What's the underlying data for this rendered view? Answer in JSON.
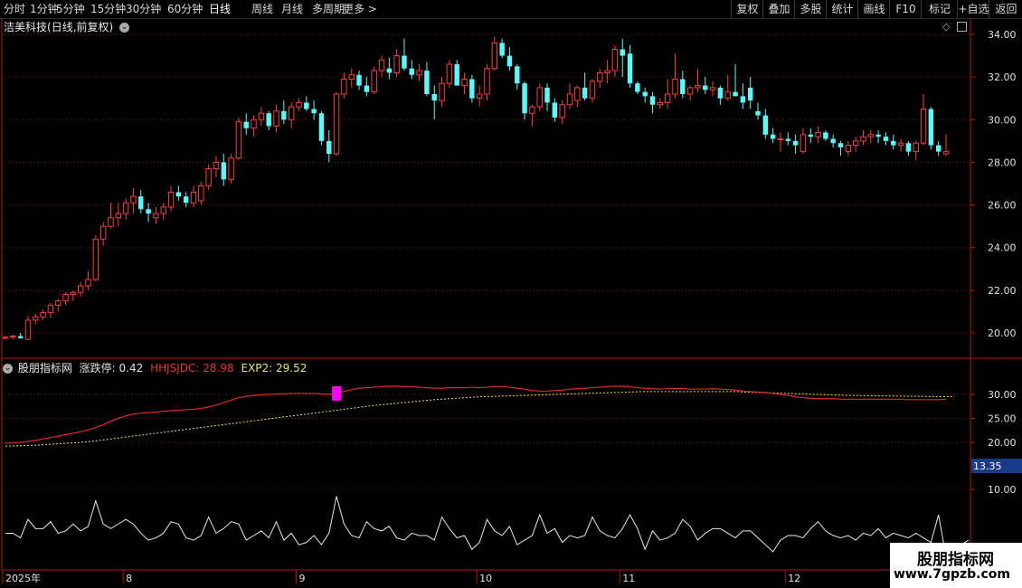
{
  "toolbar": {
    "periods": [
      "分时",
      "1分钟",
      "5分钟",
      "15分钟",
      "30分钟",
      "60分钟",
      "日线",
      "周线",
      "月线",
      "多周期",
      "更多 >"
    ],
    "active_period": "日线",
    "tools": [
      "复权",
      "叠加",
      "多股",
      "统计",
      "画线",
      "F10",
      "+自选",
      "返回"
    ],
    "marker_label": "标记"
  },
  "stock": {
    "name": "洁美科技",
    "mode": "(日线,前复权)"
  },
  "main_axis": {
    "ticks": [
      "34.00",
      "32.00",
      "30.00",
      "28.00",
      "26.00",
      "24.00",
      "22.00",
      "20.00"
    ],
    "range": [
      19.0,
      34.6
    ]
  },
  "indicator1": {
    "name": "股朋指标网",
    "items": [
      {
        "label": "涨跌停: 0.42",
        "color": "#e0e0e0"
      },
      {
        "label": "HHJSJDC: 28.98",
        "color": "#e83030"
      },
      {
        "label": "EXP2: 29.52",
        "color": "#e8e860"
      }
    ],
    "ticks": [
      "30.00",
      "25.00",
      "20.00"
    ],
    "range": [
      15.5,
      33.5
    ],
    "highlight_value": "13.35"
  },
  "indicator2": {
    "ticks": [
      "10.00"
    ],
    "range": [
      -5.5,
      13.5
    ]
  },
  "date_axis": {
    "labels": [
      {
        "text": "2025年",
        "idx": 0
      },
      {
        "text": "8",
        "idx": 16
      },
      {
        "text": "9",
        "idx": 39
      },
      {
        "text": "10",
        "idx": 63
      },
      {
        "text": "11",
        "idx": 82
      },
      {
        "text": "12",
        "idx": 104
      }
    ]
  },
  "watermark": {
    "brand": "股朋指标网",
    "url": "www.7gpzb.com"
  },
  "colors": {
    "up": "#ff3c3c",
    "down": "#54fcfc",
    "grid": "#8a1a1a",
    "axis": "#b01818",
    "hhjsjdc": "#e02828",
    "exp2": "#e6e63c",
    "wave": "#e8e8e8",
    "limit_marker": "#ff00ff"
  },
  "chart_data": {
    "type": "candlestick",
    "ohlc": [
      [
        19.75,
        19.85,
        19.7,
        19.8
      ],
      [
        19.8,
        19.9,
        19.7,
        19.85
      ],
      [
        19.85,
        20.0,
        19.75,
        19.75
      ],
      [
        19.7,
        20.8,
        19.65,
        20.6
      ],
      [
        20.6,
        20.9,
        20.4,
        20.75
      ],
      [
        20.75,
        21.1,
        20.6,
        20.95
      ],
      [
        20.95,
        21.4,
        20.7,
        21.3
      ],
      [
        21.3,
        21.6,
        21.0,
        21.5
      ],
      [
        21.5,
        21.9,
        21.3,
        21.8
      ],
      [
        21.8,
        22.0,
        21.5,
        21.9
      ],
      [
        21.9,
        22.4,
        21.7,
        22.2
      ],
      [
        22.2,
        22.9,
        22.0,
        22.5
      ],
      [
        22.5,
        24.6,
        22.4,
        24.4
      ],
      [
        24.4,
        25.2,
        24.1,
        25.0
      ],
      [
        25.0,
        26.1,
        24.9,
        25.4
      ],
      [
        25.4,
        26.1,
        25.0,
        25.6
      ],
      [
        25.6,
        26.3,
        25.3,
        26.1
      ],
      [
        26.1,
        26.8,
        25.6,
        26.4
      ],
      [
        26.4,
        26.7,
        25.6,
        25.8
      ],
      [
        25.8,
        26.1,
        25.2,
        25.6
      ],
      [
        25.4,
        25.9,
        25.1,
        25.6
      ],
      [
        25.6,
        26.1,
        25.3,
        25.9
      ],
      [
        25.9,
        26.9,
        25.7,
        26.6
      ],
      [
        26.6,
        26.9,
        26.2,
        26.4
      ],
      [
        26.4,
        26.6,
        25.9,
        26.1
      ],
      [
        26.1,
        26.9,
        25.9,
        26.6
      ],
      [
        26.2,
        27.1,
        26.0,
        26.9
      ],
      [
        26.9,
        27.9,
        26.7,
        27.7
      ],
      [
        27.7,
        28.3,
        27.3,
        28.0
      ],
      [
        28.0,
        28.4,
        26.9,
        27.2
      ],
      [
        27.2,
        28.4,
        27.0,
        28.2
      ],
      [
        28.2,
        30.1,
        28.1,
        29.9
      ],
      [
        29.9,
        30.3,
        29.3,
        29.6
      ],
      [
        29.6,
        30.2,
        29.2,
        30.0
      ],
      [
        30.0,
        30.6,
        29.7,
        30.3
      ],
      [
        30.3,
        30.4,
        29.5,
        29.7
      ],
      [
        29.7,
        30.7,
        29.4,
        30.4
      ],
      [
        30.4,
        30.9,
        29.8,
        30.0
      ],
      [
        30.0,
        30.8,
        29.6,
        30.6
      ],
      [
        30.6,
        31.0,
        30.4,
        30.8
      ],
      [
        30.8,
        31.1,
        30.4,
        30.5
      ],
      [
        30.5,
        30.9,
        30.0,
        30.3
      ],
      [
        30.3,
        30.4,
        28.8,
        29.0
      ],
      [
        29.0,
        29.5,
        28.0,
        28.4
      ],
      [
        28.4,
        31.3,
        28.3,
        31.2
      ],
      [
        31.2,
        32.2,
        31.0,
        31.9
      ],
      [
        31.9,
        32.4,
        31.5,
        32.1
      ],
      [
        32.1,
        32.3,
        31.4,
        31.6
      ],
      [
        31.6,
        32.0,
        31.1,
        31.3
      ],
      [
        31.3,
        32.5,
        31.2,
        32.3
      ],
      [
        32.3,
        33.0,
        32.0,
        32.8
      ],
      [
        32.4,
        32.9,
        31.9,
        32.2
      ],
      [
        32.2,
        33.3,
        32.0,
        33.0
      ],
      [
        33.0,
        33.8,
        32.3,
        32.4
      ],
      [
        32.4,
        32.8,
        31.9,
        32.1
      ],
      [
        32.1,
        32.6,
        31.8,
        32.3
      ],
      [
        32.3,
        32.7,
        31.1,
        31.2
      ],
      [
        31.2,
        31.6,
        30.0,
        30.9
      ],
      [
        30.9,
        32.0,
        30.6,
        31.7
      ],
      [
        31.7,
        32.8,
        31.5,
        32.6
      ],
      [
        32.6,
        32.8,
        31.6,
        31.6
      ],
      [
        31.6,
        32.2,
        31.2,
        31.9
      ],
      [
        31.9,
        32.1,
        30.8,
        31.0
      ],
      [
        31.0,
        31.6,
        30.6,
        31.2
      ],
      [
        31.2,
        32.6,
        30.9,
        32.4
      ],
      [
        32.4,
        33.9,
        32.3,
        33.6
      ],
      [
        33.6,
        33.8,
        32.9,
        33.0
      ],
      [
        33.0,
        33.4,
        32.3,
        32.5
      ],
      [
        32.5,
        32.6,
        31.4,
        31.7
      ],
      [
        31.7,
        31.8,
        30.0,
        30.3
      ],
      [
        30.3,
        30.7,
        29.7,
        30.6
      ],
      [
        30.6,
        31.7,
        30.4,
        31.5
      ],
      [
        31.5,
        31.7,
        30.4,
        30.8
      ],
      [
        30.8,
        31.0,
        29.9,
        30.1
      ],
      [
        30.1,
        30.9,
        29.8,
        30.7
      ],
      [
        30.7,
        31.7,
        30.5,
        31.2
      ],
      [
        30.9,
        31.6,
        30.6,
        31.5
      ],
      [
        31.5,
        32.2,
        30.9,
        31.0
      ],
      [
        31.0,
        31.9,
        30.8,
        31.8
      ],
      [
        31.8,
        32.4,
        31.5,
        32.2
      ],
      [
        32.2,
        32.8,
        31.7,
        32.3
      ],
      [
        32.3,
        33.5,
        32.0,
        33.3
      ],
      [
        33.3,
        33.8,
        32.0,
        33.0
      ],
      [
        33.1,
        33.5,
        31.5,
        31.7
      ],
      [
        31.7,
        31.8,
        31.2,
        31.3
      ],
      [
        31.3,
        31.5,
        30.8,
        31.1
      ],
      [
        31.1,
        31.3,
        30.3,
        30.7
      ],
      [
        30.7,
        31.0,
        30.5,
        30.8
      ],
      [
        30.8,
        31.9,
        30.5,
        31.2
      ],
      [
        31.2,
        33.1,
        31.0,
        31.9
      ],
      [
        31.9,
        32.3,
        31.0,
        31.2
      ],
      [
        31.2,
        31.6,
        30.9,
        31.5
      ],
      [
        31.5,
        32.4,
        31.3,
        31.6
      ],
      [
        31.6,
        32.0,
        31.2,
        31.4
      ],
      [
        31.4,
        31.8,
        31.1,
        31.5
      ],
      [
        31.5,
        31.6,
        30.7,
        31.0
      ],
      [
        31.0,
        32.1,
        30.9,
        31.3
      ],
      [
        31.3,
        32.6,
        31.2,
        31.1
      ],
      [
        31.1,
        31.7,
        30.5,
        30.8
      ],
      [
        31.5,
        32.0,
        30.5,
        30.9
      ],
      [
        30.4,
        30.8,
        30.0,
        30.2
      ],
      [
        30.2,
        30.5,
        29.1,
        29.3
      ],
      [
        29.3,
        29.6,
        28.9,
        29.1
      ],
      [
        29.1,
        29.4,
        28.5,
        29.1
      ],
      [
        29.1,
        29.4,
        28.8,
        29.0
      ],
      [
        29.0,
        29.3,
        28.4,
        28.8
      ],
      [
        28.5,
        29.6,
        28.4,
        29.3
      ],
      [
        29.3,
        29.6,
        28.9,
        29.2
      ],
      [
        29.2,
        29.7,
        28.9,
        29.4
      ],
      [
        29.4,
        29.5,
        29.0,
        29.1
      ],
      [
        29.1,
        29.3,
        28.7,
        28.9
      ],
      [
        28.9,
        29.0,
        28.3,
        28.7
      ],
      [
        28.5,
        29.0,
        28.3,
        28.8
      ],
      [
        28.8,
        29.2,
        28.5,
        29.0
      ],
      [
        29.0,
        29.5,
        28.8,
        29.2
      ],
      [
        29.2,
        29.5,
        28.9,
        29.3
      ],
      [
        29.3,
        29.5,
        28.9,
        29.2
      ],
      [
        29.2,
        29.4,
        28.8,
        29.0
      ],
      [
        29.0,
        29.3,
        28.6,
        28.8
      ],
      [
        28.8,
        29.1,
        28.5,
        28.9
      ],
      [
        28.9,
        29.0,
        28.3,
        28.5
      ],
      [
        28.5,
        29.0,
        28.1,
        28.9
      ],
      [
        28.9,
        31.2,
        28.8,
        30.5
      ],
      [
        30.5,
        30.6,
        28.6,
        28.8
      ],
      [
        28.8,
        29.0,
        28.3,
        28.5
      ],
      [
        28.4,
        29.3,
        28.3,
        28.5
      ]
    ],
    "indicator_hhjsjdc": [
      19.8,
      19.9,
      20.0,
      20.2,
      20.4,
      20.7,
      21.0,
      21.3,
      21.6,
      21.9,
      22.2,
      22.6,
      23.1,
      23.7,
      24.4,
      25.0,
      25.5,
      25.9,
      26.1,
      26.2,
      26.3,
      26.5,
      26.6,
      26.7,
      26.8,
      26.9,
      27.1,
      27.4,
      27.8,
      28.3,
      28.8,
      29.3,
      29.6,
      29.8,
      29.9,
      30.0,
      30.1,
      30.1,
      30.2,
      30.2,
      30.2,
      30.2,
      30.1,
      30.0,
      30.2,
      30.6,
      31.0,
      31.3,
      31.4,
      31.5,
      31.6,
      31.7,
      31.7,
      31.6,
      31.6,
      31.5,
      31.4,
      31.3,
      31.3,
      31.4,
      31.4,
      31.4,
      31.5,
      31.4,
      31.5,
      31.6,
      31.6,
      31.5,
      31.3,
      31.1,
      30.8,
      30.7,
      30.7,
      30.8,
      30.9,
      31.1,
      31.2,
      31.3,
      31.4,
      31.5,
      31.6,
      31.7,
      31.7,
      31.6,
      31.4,
      31.3,
      31.2,
      31.1,
      31.2,
      31.2,
      31.2,
      31.1,
      31.1,
      31.1,
      31.2,
      31.1,
      31.0,
      30.9,
      30.7,
      30.6,
      30.5,
      30.4,
      30.2,
      30.0,
      29.8,
      29.5,
      29.3,
      29.2,
      29.1,
      29.1,
      29.1,
      29.0,
      29.0,
      29.0,
      29.0,
      29.0,
      29.0,
      29.0,
      29.0,
      29.0,
      28.9,
      28.9,
      28.9,
      28.9,
      28.9,
      28.98
    ],
    "indicator_exp2": [
      19.2,
      19.25,
      19.3,
      19.35,
      19.4,
      19.5,
      19.6,
      19.7,
      19.8,
      19.9,
      20.0,
      20.15,
      20.3,
      20.5,
      20.7,
      20.9,
      21.1,
      21.3,
      21.5,
      21.7,
      21.9,
      22.1,
      22.3,
      22.5,
      22.7,
      22.9,
      23.1,
      23.3,
      23.5,
      23.7,
      23.9,
      24.1,
      24.3,
      24.5,
      24.7,
      24.9,
      25.1,
      25.3,
      25.5,
      25.7,
      25.9,
      26.1,
      26.3,
      26.5,
      26.7,
      26.9,
      27.1,
      27.3,
      27.5,
      27.7,
      27.85,
      28.0,
      28.15,
      28.3,
      28.45,
      28.6,
      28.75,
      28.9,
      29.0,
      29.1,
      29.2,
      29.3,
      29.4,
      29.5,
      29.55,
      29.6,
      29.65,
      29.7,
      29.75,
      29.8,
      29.85,
      29.9,
      29.95,
      30.0,
      30.05,
      30.1,
      30.15,
      30.2,
      30.25,
      30.3,
      30.35,
      30.4,
      30.45,
      30.5,
      30.55,
      30.6,
      30.6,
      30.6,
      30.6,
      30.6,
      30.6,
      30.6,
      30.6,
      30.6,
      30.6,
      30.6,
      30.6,
      30.6,
      30.5,
      30.45,
      30.4,
      30.35,
      30.3,
      30.25,
      30.2,
      30.15,
      30.1,
      30.05,
      30.0,
      29.95,
      29.9,
      29.85,
      29.8,
      29.78,
      29.75,
      29.72,
      29.7,
      29.68,
      29.66,
      29.64,
      29.62,
      29.6,
      29.58,
      29.56,
      29.54,
      29.53,
      29.52
    ],
    "limit_marker_index": 44,
    "indicator_wave": [
      0.5,
      0.5,
      -0.5,
      3.5,
      1.5,
      1.5,
      3.0,
      0.5,
      1.0,
      2.5,
      1.0,
      2.0,
      7.5,
      2.5,
      1.5,
      2.5,
      3.5,
      2.5,
      0.5,
      -1.0,
      -0.5,
      0.5,
      3.0,
      2.5,
      -0.5,
      -1.0,
      0.0,
      4.0,
      0.5,
      1.5,
      3.0,
      2.5,
      -1.0,
      0.0,
      1.0,
      -0.5,
      3.0,
      -1.0,
      0.5,
      -2.0,
      -1.5,
      0.0,
      -2.0,
      0.5,
      8.5,
      2.5,
      0.0,
      -0.5,
      3.0,
      1.5,
      1.0,
      2.0,
      -0.5,
      -1.0,
      0.5,
      0.0,
      0.0,
      -1.0,
      4.0,
      1.5,
      -0.5,
      0.0,
      -3.0,
      -1.5,
      3.5,
      1.0,
      0.0,
      2.0,
      -2.0,
      -1.0,
      0.0,
      4.5,
      0.5,
      1.5,
      -1.5,
      0.0,
      -0.5,
      0.0,
      4.0,
      1.0,
      0.0,
      -0.5,
      1.5,
      4.5,
      1.5,
      -3.0,
      1.0,
      -1.0,
      -0.5,
      0.5,
      3.5,
      2.0,
      -1.0,
      0.5,
      1.5,
      1.5,
      0.5,
      -0.5,
      1.0,
      1.0,
      -0.5,
      -2.0,
      -3.5,
      -1.0,
      0.0,
      0.0,
      -0.5,
      1.5,
      3.0,
      1.0,
      0.0,
      -0.5,
      0.0,
      -1.0,
      0.5,
      0.0,
      1.5,
      -0.5,
      0.5,
      0.0,
      -0.5,
      0.5,
      -0.5,
      -1.5,
      4.5,
      -4.5,
      -2.5,
      -2.0,
      -1.0
    ]
  }
}
